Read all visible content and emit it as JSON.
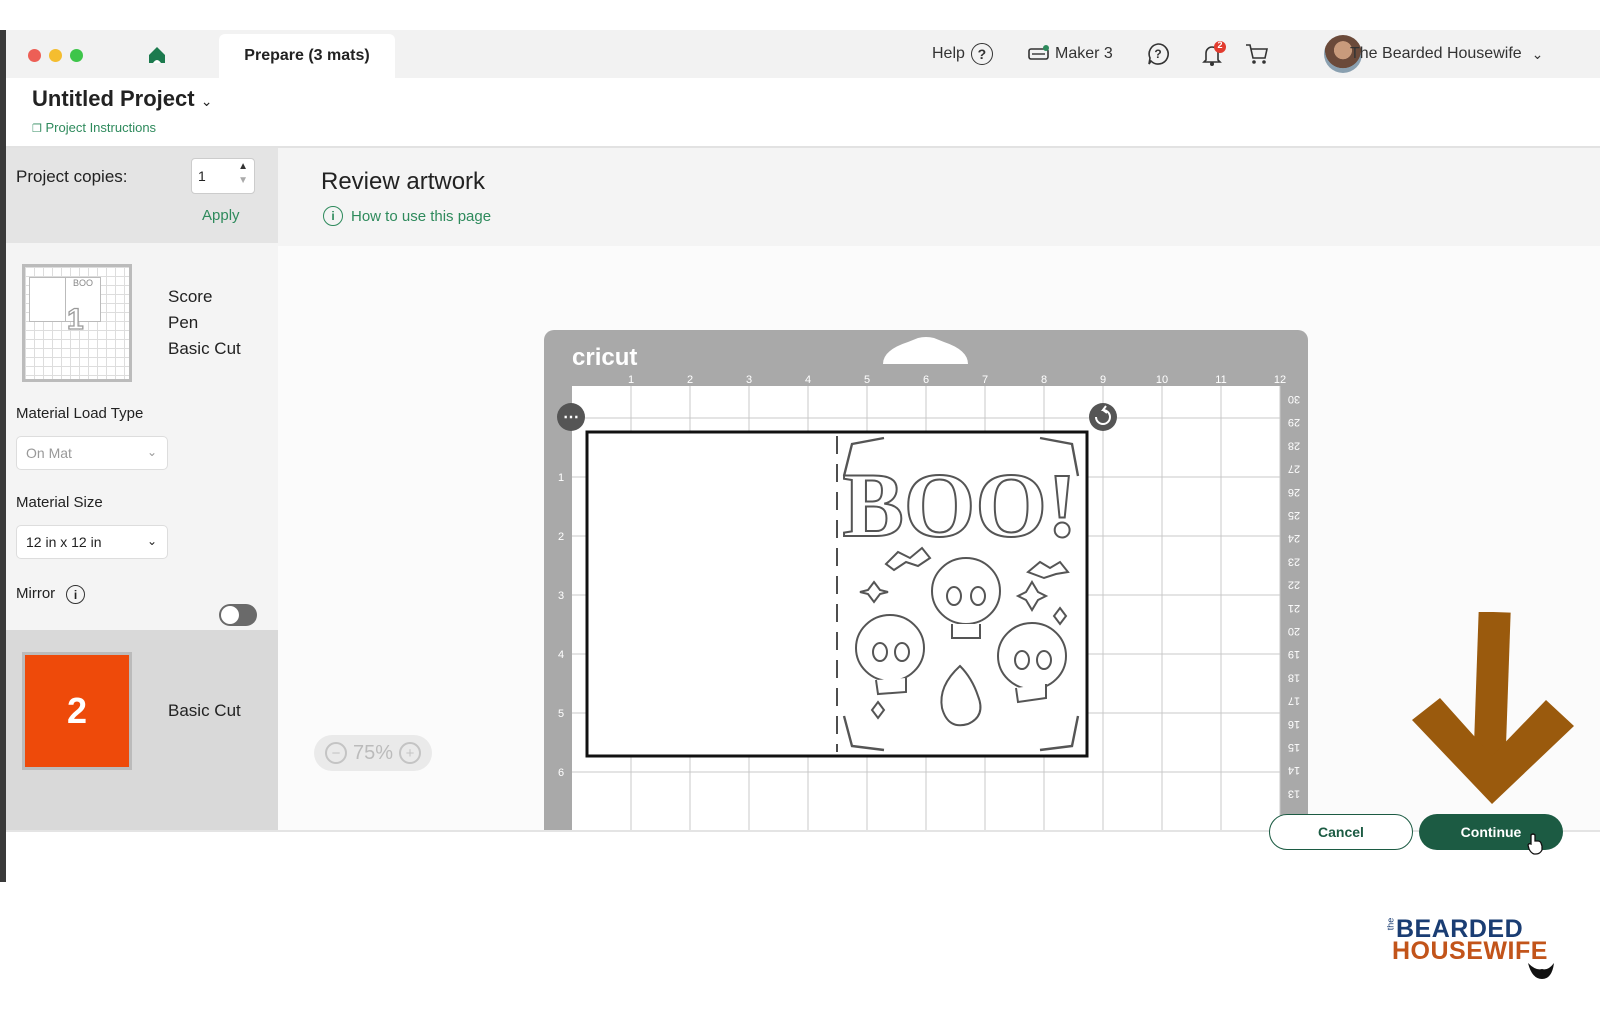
{
  "tab": {
    "label": "Prepare (3 mats)"
  },
  "topnav": {
    "help_label": "Help",
    "machine_label": "Maker 3",
    "notification_count": "2",
    "user_name": "The Bearded Housewife"
  },
  "project": {
    "title": "Untitled Project",
    "instructions_link": "Project Instructions"
  },
  "sidebar": {
    "copies_label": "Project copies:",
    "copies_value": "1",
    "apply_label": "Apply",
    "mat1_number": "1",
    "mat1_operations": [
      "Score",
      "Pen",
      "Basic Cut"
    ],
    "load_type_label": "Material Load Type",
    "load_type_value": "On Mat",
    "size_label": "Material Size",
    "size_value": "12 in x 12 in",
    "mirror_label": "Mirror",
    "mirror_on": false,
    "mat2_number": "2",
    "mat2_operation": "Basic Cut",
    "mat2_color": "#ee4a0a"
  },
  "main": {
    "review_title": "Review artwork",
    "howto_label": "How to use this page",
    "zoom_label": "75%"
  },
  "mat": {
    "brand": "cricut",
    "top_ruler": [
      "1",
      "2",
      "3",
      "4",
      "5",
      "6",
      "7",
      "8",
      "9",
      "10",
      "11",
      "12"
    ],
    "left_ruler": [
      "1",
      "2",
      "3",
      "4",
      "5",
      "6"
    ],
    "right_ruler": [
      "30",
      "29",
      "28",
      "27",
      "26",
      "25",
      "24",
      "23",
      "22",
      "21",
      "20",
      "19",
      "18",
      "17",
      "16",
      "15",
      "14",
      "13"
    ],
    "artwork_text": "BOO!"
  },
  "footer": {
    "cancel_label": "Cancel",
    "continue_label": "Continue"
  },
  "watermark": {
    "line0": "the",
    "line1": "BEARDED",
    "line2": "HOUSEWIFE"
  },
  "colors": {
    "accent_green": "#1c5b43",
    "link_green": "#2e8a5c",
    "arrow_brown": "#9a5a0d",
    "notification_red": "#e23b2e"
  }
}
